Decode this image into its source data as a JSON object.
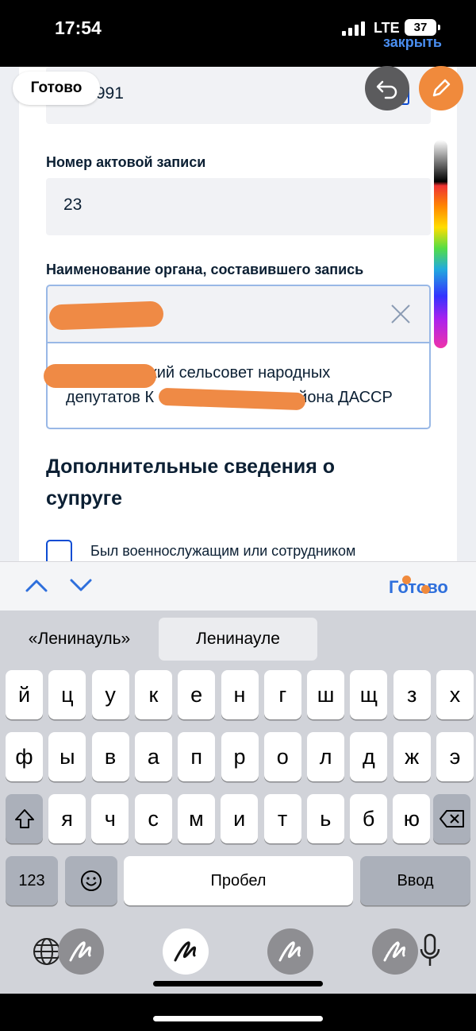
{
  "status_bar": {
    "time": "17:54",
    "network": "LTE",
    "battery": "37",
    "close_link": "закрыть"
  },
  "markup": {
    "done_label": "Готово",
    "undo_icon": "undo-icon",
    "pen_icon": "pencil-icon"
  },
  "form": {
    "date_value": "05.1991",
    "record_number_label": "Номер актовой записи",
    "record_number_value": "23",
    "authority_label": "Наименование органа, составившего запись",
    "suggestion_line1": "ский сельсовет народных",
    "suggestion_line2_a": "депутатов К",
    "suggestion_line2_b": "йона ДАССР",
    "spouse_section_title": "Дополнительные сведения о супруге",
    "military_checkbox_label": "Был военнослужащим или сотрудником"
  },
  "accessory": {
    "done_label": "Готово"
  },
  "keyboard": {
    "suggestions": [
      "«Ленинауль»",
      "Ленинауле"
    ],
    "row1": [
      "й",
      "ц",
      "у",
      "к",
      "е",
      "н",
      "г",
      "ш",
      "щ",
      "з",
      "х"
    ],
    "row2": [
      "ф",
      "ы",
      "в",
      "а",
      "п",
      "р",
      "о",
      "л",
      "д",
      "ж",
      "э"
    ],
    "row3": [
      "я",
      "ч",
      "с",
      "м",
      "и",
      "т",
      "ь",
      "б",
      "ю"
    ],
    "numbers_key": "123",
    "space_key": "Пробел",
    "return_key": "Ввод"
  },
  "colors": {
    "accent": "#0d4cd3",
    "markup_orange": "#f08a3c",
    "text": "#0b1f33"
  }
}
